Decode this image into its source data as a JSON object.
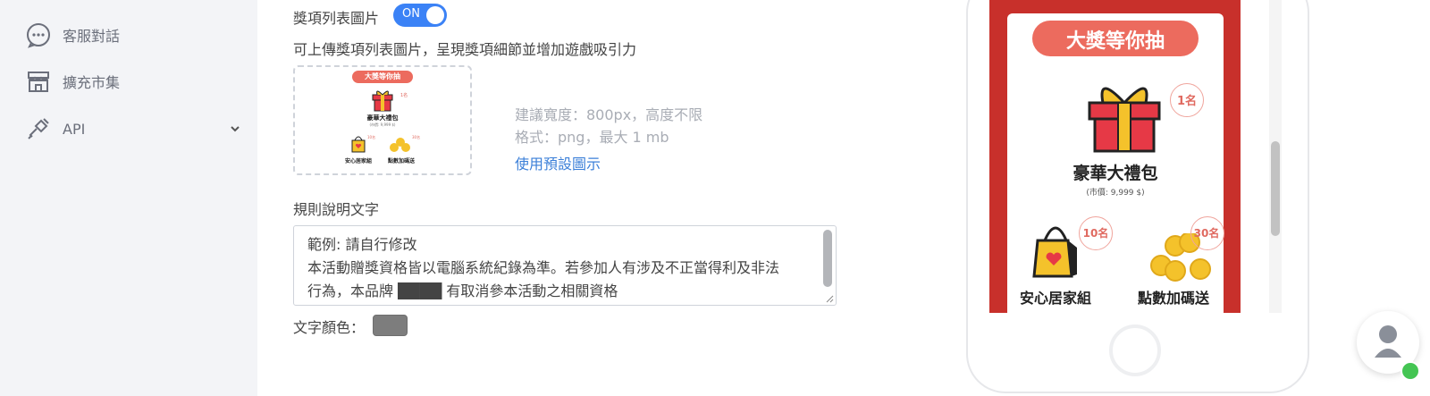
{
  "sidebar": {
    "items": [
      {
        "label": "客服對話",
        "icon": "chat-bubble-icon"
      },
      {
        "label": "擴充市集",
        "icon": "store-icon"
      },
      {
        "label": "API",
        "icon": "plug-icon"
      }
    ]
  },
  "prize_image": {
    "label": "獎項列表圖片",
    "toggle_label": "ON",
    "description": "可上傳獎項列表圖片，呈現獎項細節並增加遊戲吸引力",
    "hint_size": "建議寬度：800px，高度不限",
    "hint_format": "格式：png，最大 1 mb",
    "default_link": "使用預設圖示"
  },
  "thumbnail": {
    "banner": "大獎等你抽",
    "badge_top": "1名",
    "main_prize": "豪華大禮包",
    "main_price": "(市價: 9,999 $)",
    "prize_left": "安心居家組",
    "prize_right": "點數加碼送",
    "badge_left": "10名",
    "badge_right": "30名"
  },
  "rules": {
    "label": "規則說明文字",
    "lines": [
      "範例: 請自行修改",
      "本活動贈獎資格皆以電腦系統紀錄為準。若參加人有涉及不正當得利及非法",
      "行為，本品牌 ████ 有取消參本活動之相關資格"
    ]
  },
  "text_color": {
    "label": "文字顏色：",
    "value": "#7d7d7d"
  },
  "preview": {
    "banner": "大獎等你抽",
    "main_badge": "1名",
    "main_prize": "豪華大禮包",
    "main_price": "(市價: 9,999 $)",
    "left_badge": "10名",
    "right_badge": "30名",
    "left_prize": "安心居家組",
    "right_prize": "點數加碼送"
  },
  "colors": {
    "accent": "#3b82f6",
    "banner": "#ec6b5e",
    "screen_red": "#c8302b",
    "online": "#44c553"
  }
}
